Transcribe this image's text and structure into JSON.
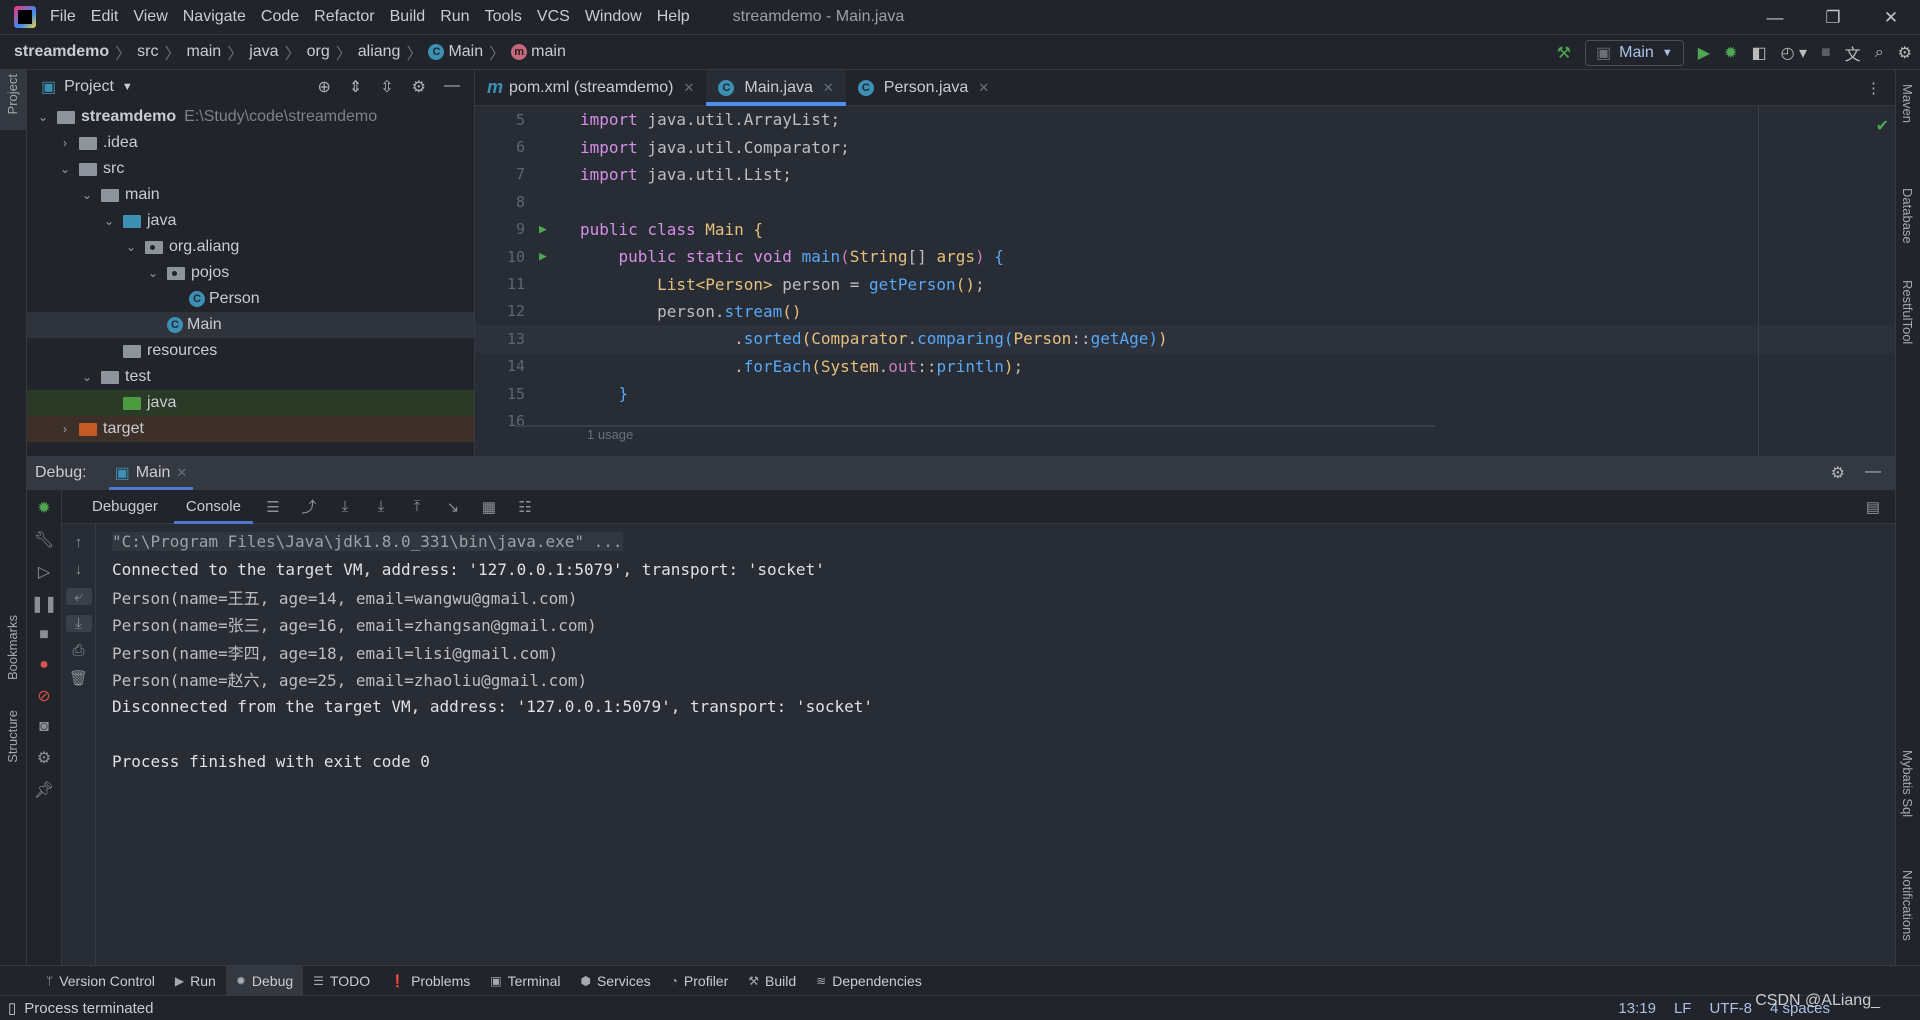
{
  "titlebar": {
    "menu": [
      "File",
      "Edit",
      "View",
      "Navigate",
      "Code",
      "Refactor",
      "Build",
      "Run",
      "Tools",
      "VCS",
      "Window",
      "Help"
    ],
    "title": "streamdemo - Main.java"
  },
  "breadcrumb": [
    "streamdemo",
    "src",
    "main",
    "java",
    "org",
    "aliang",
    "Main",
    "main"
  ],
  "toolbar": {
    "run_config": "Main"
  },
  "left_stripe": {
    "project": "Project",
    "bookmarks": "Bookmarks",
    "structure": "Structure"
  },
  "right_stripe": [
    "Maven",
    "Database",
    "RestfulTool",
    "Mybatis Sql",
    "Notifications"
  ],
  "project": {
    "title": "Project",
    "tree": [
      {
        "label": "streamdemo",
        "hint": "E:\\Study\\code\\streamdemo",
        "depth": 0,
        "arrow": "down",
        "icon": "module",
        "bold": true
      },
      {
        "label": ".idea",
        "depth": 1,
        "arrow": "right",
        "icon": "folder"
      },
      {
        "label": "src",
        "depth": 1,
        "arrow": "down",
        "icon": "folder"
      },
      {
        "label": "main",
        "depth": 2,
        "arrow": "down",
        "icon": "folder"
      },
      {
        "label": "java",
        "depth": 3,
        "arrow": "down",
        "icon": "source-folder"
      },
      {
        "label": "org.aliang",
        "depth": 4,
        "arrow": "down",
        "icon": "package"
      },
      {
        "label": "pojos",
        "depth": 5,
        "arrow": "down",
        "icon": "package"
      },
      {
        "label": "Person",
        "depth": 6,
        "icon": "class"
      },
      {
        "label": "Main",
        "depth": 5,
        "icon": "class-main",
        "selected": true
      },
      {
        "label": "resources",
        "depth": 3,
        "icon": "resources-folder"
      },
      {
        "label": "test",
        "depth": 2,
        "arrow": "down",
        "icon": "folder"
      },
      {
        "label": "java",
        "depth": 3,
        "icon": "test-folder",
        "highlight": "test"
      },
      {
        "label": "target",
        "depth": 1,
        "arrow": "right",
        "icon": "excluded-folder",
        "highlight": "target"
      }
    ]
  },
  "editor": {
    "tabs": [
      {
        "label": "pom.xml (streamdemo)",
        "icon": "maven"
      },
      {
        "label": "Main.java",
        "icon": "class-main",
        "active": true
      },
      {
        "label": "Person.java",
        "icon": "class"
      }
    ],
    "lines": [
      {
        "n": "5",
        "tokens": [
          [
            "import",
            "k"
          ],
          [
            " java.util.ArrayList;",
            ""
          ]
        ]
      },
      {
        "n": "6",
        "tokens": [
          [
            "import",
            "k"
          ],
          [
            " java.util.Comparator;",
            ""
          ]
        ]
      },
      {
        "n": "7",
        "tokens": [
          [
            "import",
            "k"
          ],
          [
            " java.util.List;",
            ""
          ]
        ]
      },
      {
        "n": "8",
        "tokens": []
      },
      {
        "n": "9",
        "run": true,
        "tokens": [
          [
            "public class ",
            "k"
          ],
          [
            "Main ",
            "t"
          ],
          [
            "{",
            "p1"
          ]
        ]
      },
      {
        "n": "10",
        "run": true,
        "tokens": [
          [
            "    public static void ",
            "k"
          ],
          [
            "main",
            "m"
          ],
          [
            "(",
            "p2"
          ],
          [
            "String",
            "t"
          ],
          [
            "[] ",
            ""
          ],
          [
            "args",
            "t"
          ],
          [
            ") ",
            "p2"
          ],
          [
            "{",
            "p3"
          ]
        ]
      },
      {
        "n": "11",
        "tokens": [
          [
            "        ",
            ""
          ],
          [
            "List<Person>",
            "t"
          ],
          [
            " person = ",
            ""
          ],
          [
            "getPerson",
            "m"
          ],
          [
            "()",
            "p1"
          ],
          [
            ";",
            ""
          ]
        ]
      },
      {
        "n": "12",
        "tokens": [
          [
            "        person.",
            ""
          ],
          [
            "stream",
            "m"
          ],
          [
            "()",
            "p1"
          ]
        ]
      },
      {
        "n": "13",
        "current": true,
        "tokens": [
          [
            "                .",
            ""
          ],
          [
            "sorted",
            "m"
          ],
          [
            "(",
            "p1"
          ],
          [
            "Comparator",
            "t"
          ],
          [
            ".",
            ""
          ],
          [
            "comparing",
            "m"
          ],
          [
            "(",
            "p3"
          ],
          [
            "Person",
            "t"
          ],
          [
            "::",
            ""
          ],
          [
            "getAge",
            "m"
          ],
          [
            ")",
            "p3"
          ],
          [
            ")",
            "p1"
          ]
        ]
      },
      {
        "n": "14",
        "tokens": [
          [
            "                .",
            ""
          ],
          [
            "forEach",
            "m"
          ],
          [
            "(",
            "p1"
          ],
          [
            "System",
            "t"
          ],
          [
            ".",
            ""
          ],
          [
            "out",
            "f"
          ],
          [
            "::",
            ""
          ],
          [
            "println",
            "m"
          ],
          [
            ")",
            "p1"
          ],
          [
            ";",
            ""
          ]
        ]
      },
      {
        "n": "15",
        "tokens": [
          [
            "    }",
            "p3"
          ]
        ]
      },
      {
        "n": "16",
        "tokens": []
      }
    ],
    "usage_hint": "1 usage"
  },
  "debug": {
    "label": "Debug:",
    "session": "Main",
    "tabs": [
      "Debugger",
      "Console"
    ],
    "active_tab": "Console"
  },
  "console": [
    {
      "text": "\"C:\\Program Files\\Java\\jdk1.8.0_331\\bin\\java.exe\" ...",
      "kind": "cmd"
    },
    {
      "text": "Connected to the target VM, address: '127.0.0.1:5079', transport: 'socket'",
      "kind": "sys"
    },
    {
      "text": "Person(name=王五, age=14, email=wangwu@gmail.com)",
      "kind": "out"
    },
    {
      "text": "Person(name=张三, age=16, email=zhangsan@gmail.com)",
      "kind": "out"
    },
    {
      "text": "Person(name=李四, age=18, email=lisi@gmail.com)",
      "kind": "out"
    },
    {
      "text": "Person(name=赵六, age=25, email=zhaoliu@gmail.com)",
      "kind": "out"
    },
    {
      "text": "Disconnected from the target VM, address: '127.0.0.1:5079', transport: 'socket'",
      "kind": "sys"
    },
    {
      "text": "",
      "kind": "sys"
    },
    {
      "text": "Process finished with exit code 0",
      "kind": "sys"
    }
  ],
  "toolwindows": [
    {
      "label": "Version Control",
      "icon": "branch"
    },
    {
      "label": "Run",
      "icon": "play"
    },
    {
      "label": "Debug",
      "icon": "bug",
      "active": true
    },
    {
      "label": "TODO",
      "icon": "list"
    },
    {
      "label": "Problems",
      "icon": "alert"
    },
    {
      "label": "Terminal",
      "icon": "terminal"
    },
    {
      "label": "Services",
      "icon": "services"
    },
    {
      "label": "Profiler",
      "icon": "profiler"
    },
    {
      "label": "Build",
      "icon": "hammer"
    },
    {
      "label": "Dependencies",
      "icon": "layers"
    }
  ],
  "status": {
    "message": "Process terminated",
    "position": "13:19",
    "line_sep": "LF",
    "encoding": "UTF-8",
    "indent": "4 spaces"
  },
  "watermark": "CSDN @ALiang_",
  "colors": {
    "accent": "#4d8ef0",
    "run_green": "#4fa653",
    "keyword": "#d58fe6",
    "method": "#57a8f5",
    "type": "#e5c07b"
  }
}
